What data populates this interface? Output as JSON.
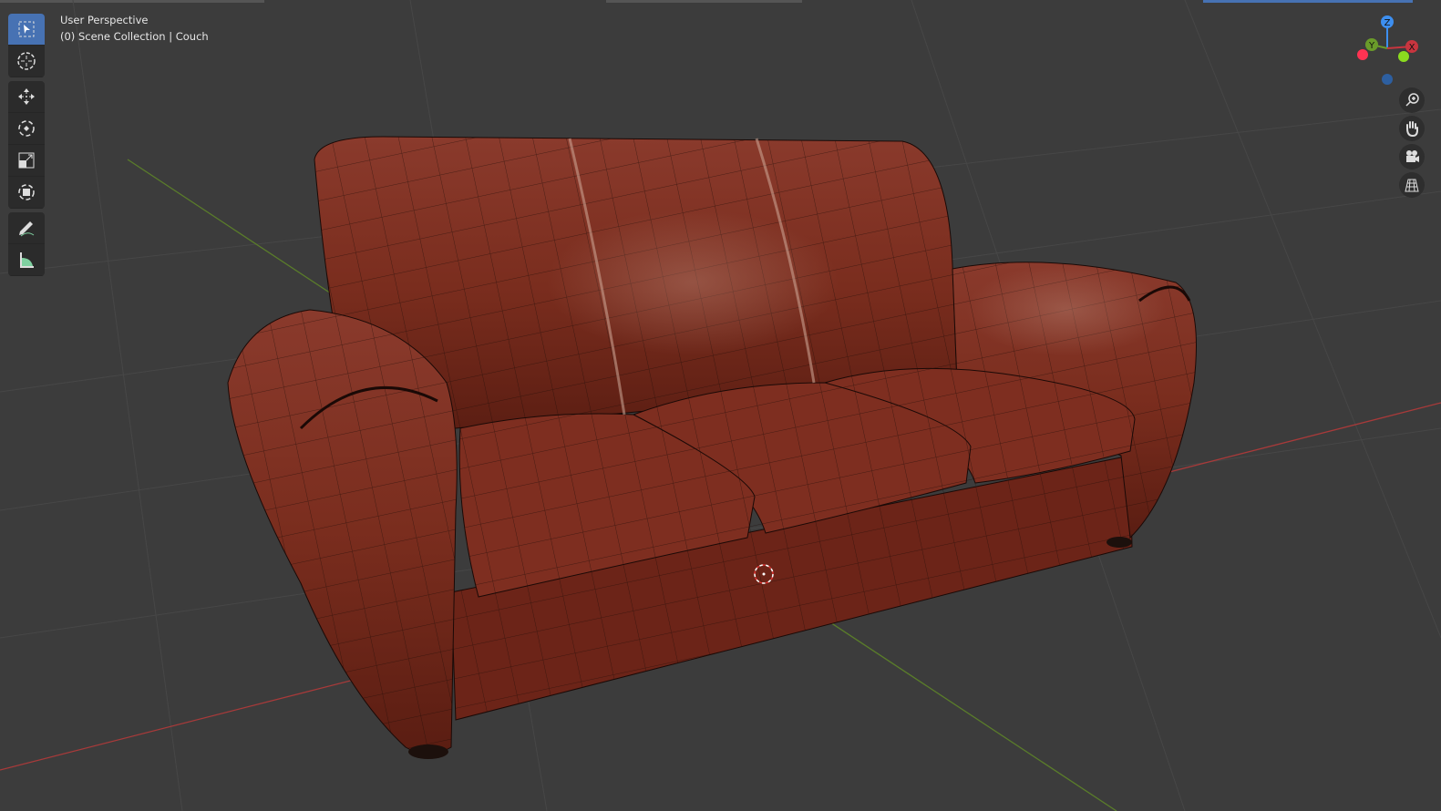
{
  "viewport": {
    "view_name": "User Perspective",
    "collection_info": "(0) Scene Collection | Couch"
  },
  "toolbar": {
    "tools": [
      {
        "name": "select-box",
        "icon": "select-box-icon",
        "active": true
      },
      {
        "name": "cursor",
        "icon": "cursor-icon"
      },
      {
        "name": "move",
        "icon": "move-icon"
      },
      {
        "name": "rotate",
        "icon": "rotate-icon"
      },
      {
        "name": "scale",
        "icon": "scale-icon"
      },
      {
        "name": "transform",
        "icon": "transform-icon"
      },
      {
        "name": "annotate",
        "icon": "annotate-icon"
      },
      {
        "name": "measure",
        "icon": "measure-icon"
      }
    ]
  },
  "gizmo": {
    "x_label": "X",
    "y_label": "Y",
    "z_label": "Z"
  },
  "nav_buttons": [
    "zoom-icon",
    "pan-hand-icon",
    "camera-icon",
    "grid-ortho-icon"
  ],
  "colors": {
    "active": "#4772b3",
    "x_axis": "#c8353f",
    "y_axis": "#6a9b2a",
    "z_axis": "#3d8ff0",
    "leather": "#7a2a1c"
  }
}
